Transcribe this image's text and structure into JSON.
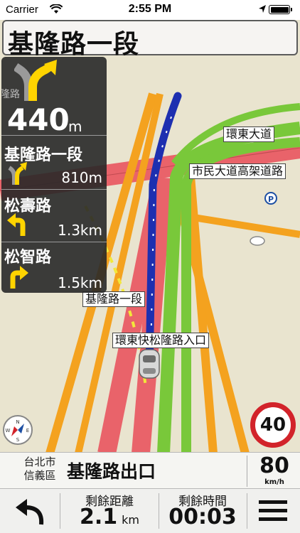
{
  "status_bar": {
    "carrier": "Carrier",
    "time": "2:55 PM"
  },
  "current_road": "基隆路一段",
  "guidance": {
    "next_turn_distance": "440",
    "next_turn_unit": "m",
    "steps": [
      {
        "road": "基隆路一段",
        "distance": "810m",
        "icon": "keep-right-fork-icon"
      },
      {
        "road": "松壽路",
        "distance": "1.3km",
        "icon": "turn-left-icon"
      },
      {
        "road": "松智路",
        "distance": "1.5km",
        "icon": "turn-right-icon"
      }
    ]
  },
  "map_labels": {
    "ring_east": "環東大道",
    "civic_elevated": "市民大道高架道路",
    "keelung_rd": "基隆路一段",
    "ramp": "環東快松隆路入口",
    "partial_left": "隆路"
  },
  "speed_limit": "40",
  "info_bar": {
    "city": "台北市",
    "district": "信義區",
    "next_road": "基隆路出口",
    "speed": "80",
    "speed_unit": "km/h"
  },
  "toolbar": {
    "remaining_distance_label": "剩餘距離",
    "remaining_distance_value": "2.1",
    "remaining_distance_unit": "km",
    "remaining_time_label": "剩餘時間",
    "remaining_time_value": "00:03"
  },
  "colors": {
    "route": "#1d2fb0",
    "highway": "#79c83a",
    "major_road": "#e9636a",
    "secondary_road": "#f4a21f",
    "speed_sign_ring": "#d2232a"
  }
}
